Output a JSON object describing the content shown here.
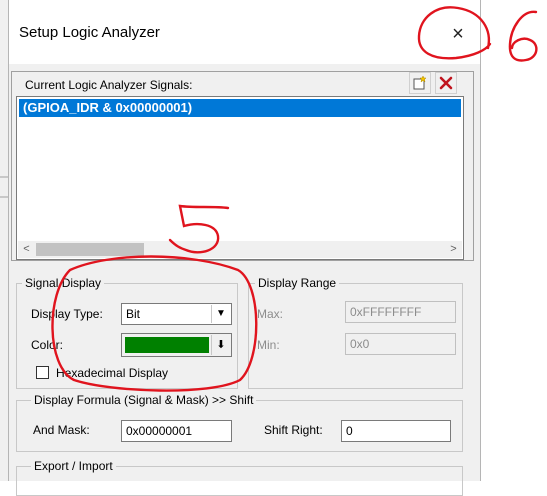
{
  "dialog": {
    "title": "Setup Logic Analyzer",
    "close_symbol": "×",
    "signals": {
      "label": "Current Logic Analyzer Signals:",
      "new_button_icon": "new-signal-icon",
      "delete_button_icon": "delete-signal-icon",
      "items": [
        "(GPIOA_IDR & 0x00000001)"
      ],
      "scroll_left": "<",
      "scroll_right": ">"
    },
    "signal_display": {
      "title": "Signal Display",
      "display_type_label": "Display Type:",
      "display_type_value": "Bit",
      "color_label": "Color:",
      "color_value": "#008000",
      "hex_display_label": "Hexadecimal Display",
      "hex_display_checked": false
    },
    "display_range": {
      "title": "Display Range",
      "max_label": "Max:",
      "max_value": "0xFFFFFFFF",
      "min_label": "Min:",
      "min_value": "0x0"
    },
    "display_formula": {
      "title": "Display Formula (Signal & Mask) >> Shift",
      "and_mask_label": "And Mask:",
      "and_mask_value": "0x00000001",
      "shift_right_label": "Shift Right:",
      "shift_right_value": "0"
    },
    "export_import": {
      "title": "Export / Import"
    }
  },
  "annotations": {
    "mark_5": "5",
    "mark_6": "6",
    "color": "#e0141e"
  }
}
